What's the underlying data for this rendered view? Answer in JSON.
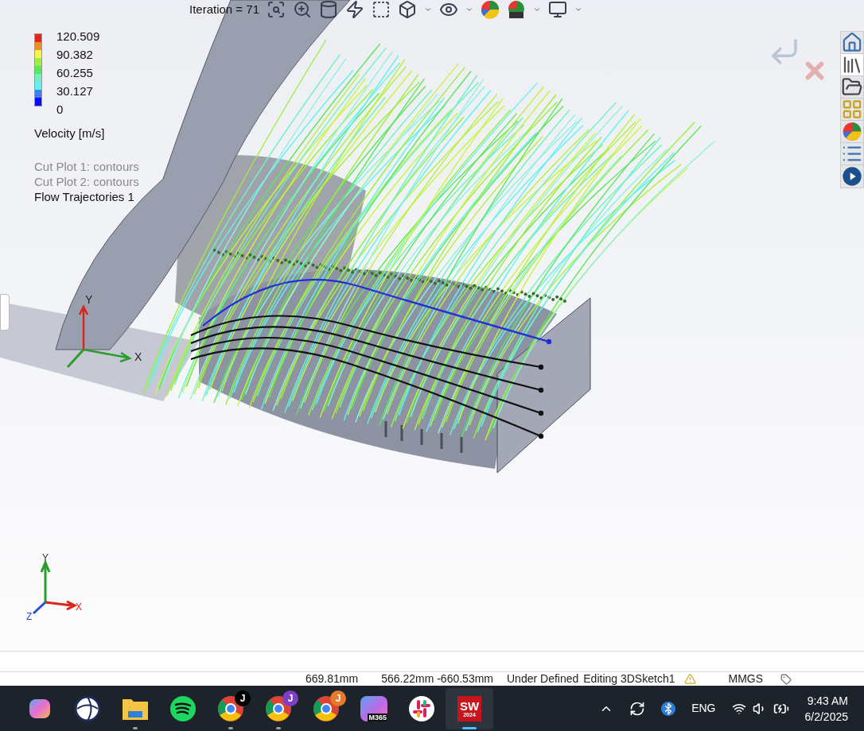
{
  "viewport": {
    "iteration": "Iteration = 71",
    "legend": {
      "values": [
        "120.509",
        "90.382",
        "60.255",
        "30.127",
        "0"
      ],
      "title": "Velocity [m/s]"
    },
    "plots": [
      {
        "label": "Cut Plot 1: contours",
        "visible": false
      },
      {
        "label": "Cut Plot 2: contours",
        "visible": false
      },
      {
        "label": "Flow Trajectories 1",
        "visible": true
      }
    ],
    "model_triad": {
      "x": "X",
      "y": "Y"
    },
    "view_triad": {
      "x": "X",
      "y": "Y",
      "z": "Z"
    }
  },
  "status_bar": [
    {
      "text": "669.81mm"
    },
    {
      "text": "566.22mm -660.53mm"
    },
    {
      "text": "Under Defined"
    },
    {
      "text": "Editing 3DSketch1"
    },
    {
      "text": "MMGS"
    }
  ],
  "taskbar": {
    "apps": [
      {
        "kind": "copilot",
        "running": false,
        "active": false
      },
      {
        "kind": "globe",
        "running": false,
        "active": false
      },
      {
        "kind": "folder",
        "running": true,
        "active": false
      },
      {
        "kind": "spotify",
        "running": false,
        "active": false
      },
      {
        "kind": "chrome",
        "badge": "J",
        "color": "#000000",
        "running": true,
        "active": false
      },
      {
        "kind": "chrome",
        "badge": "J",
        "color": "#7b3fc4",
        "running": true,
        "active": false
      },
      {
        "kind": "chrome",
        "badge": "J",
        "color": "#e8782a",
        "running": false,
        "active": false
      },
      {
        "kind": "m365",
        "label": "M365",
        "running": false,
        "active": false
      },
      {
        "kind": "slack",
        "running": false,
        "active": false
      },
      {
        "kind": "solidworks",
        "label": "SW",
        "sublabel": "2024",
        "running": true,
        "active": true
      }
    ]
  },
  "tray": {
    "language": "ENG",
    "time": "9:43 AM",
    "date": "6/2/2025"
  }
}
